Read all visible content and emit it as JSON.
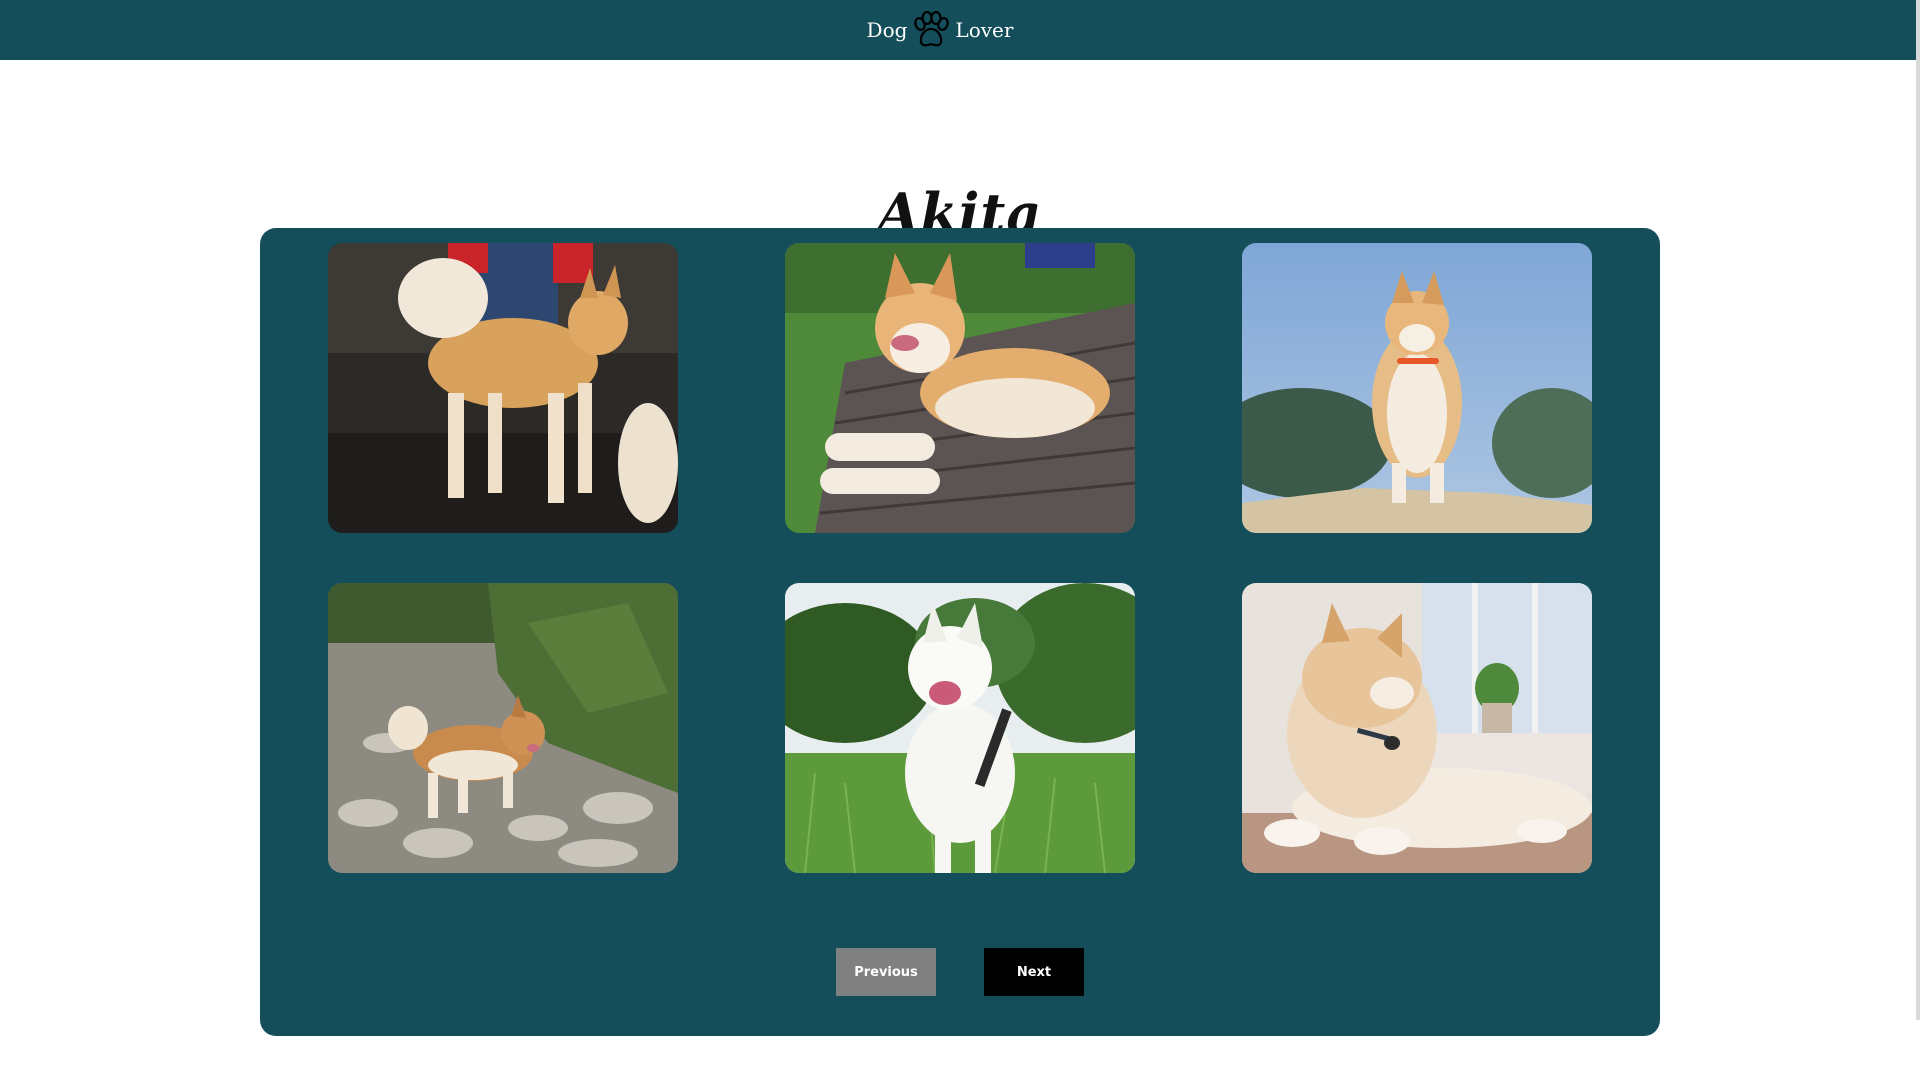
{
  "header": {
    "brand_left": "Dog",
    "brand_right": "Lover",
    "brand_icon": "paw-icon",
    "color": "#134e5a"
  },
  "page": {
    "title": "Akita"
  },
  "gallery": {
    "panel_color": "#134e5a",
    "photos": [
      {
        "alt": "akita-photo-1"
      },
      {
        "alt": "akita-photo-2"
      },
      {
        "alt": "akita-photo-3"
      },
      {
        "alt": "akita-photo-4"
      },
      {
        "alt": "akita-photo-5"
      },
      {
        "alt": "akita-photo-6"
      }
    ]
  },
  "pagination": {
    "previous_label": "Previous",
    "next_label": "Next",
    "previous_color": "#808080",
    "next_color": "#000000"
  }
}
